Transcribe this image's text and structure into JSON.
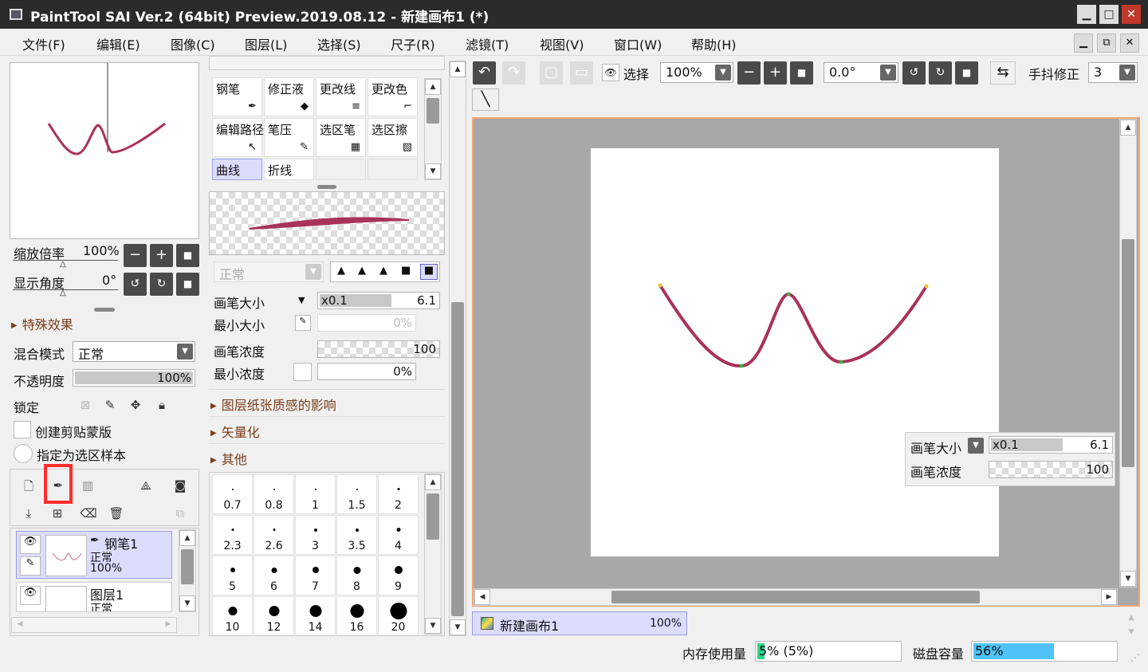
{
  "window": {
    "title": "PaintTool SAI Ver.2 (64bit) Preview.2019.08.12 - 新建画布1 (*)",
    "min": "▁",
    "max": "□",
    "close": "✕"
  },
  "menu": [
    "文件(F)",
    "编辑(E)",
    "图像(C)",
    "图层(L)",
    "选择(S)",
    "尺子(R)",
    "滤镜(T)",
    "视图(V)",
    "窗口(W)",
    "帮助(H)"
  ],
  "mdi": {
    "min": "▁",
    "restore": "⧉",
    "close": "✕"
  },
  "navigator": {
    "zoom_label": "缩放倍率",
    "zoom_value": "100%",
    "angle_label": "显示角度",
    "angle_value": "0°"
  },
  "layer_props": {
    "effects": "特殊效果",
    "blend_label": "混合模式",
    "blend_value": "正常",
    "opacity_label": "不透明度",
    "opacity_value": "100%",
    "lock_label": "锁定",
    "clip_label": "创建剪贴蒙版",
    "sample_label": "指定为选区样本"
  },
  "layers": [
    {
      "name": "钢笔1",
      "mode": "正常",
      "opacity": "100%",
      "selected": true
    },
    {
      "name": "图层1",
      "mode": "正常",
      "opacity": "",
      "selected": false
    }
  ],
  "tools": [
    {
      "name": "钢笔",
      "icon": "✒"
    },
    {
      "name": "修正液",
      "icon": "◆"
    },
    {
      "name": "更改线",
      "icon": "≡"
    },
    {
      "name": "更改色",
      "icon": "⌐"
    },
    {
      "name": "编辑路径",
      "icon": "↖"
    },
    {
      "name": "笔压",
      "icon": "✎"
    },
    {
      "name": "选区笔",
      "icon": "▦"
    },
    {
      "name": "选区擦",
      "icon": "▧"
    },
    {
      "name": "曲线",
      "icon": ""
    },
    {
      "name": "折线",
      "icon": ""
    }
  ],
  "brush": {
    "blend_value": "正常",
    "size_label": "画笔大小",
    "size_mult": "x0.1",
    "size_value": "6.1",
    "min_size_label": "最小大小",
    "min_size_value": "0%",
    "density_label": "画笔浓度",
    "density_value": "100",
    "min_density_label": "最小浓度",
    "min_density_value": "0%",
    "sections": [
      "图层纸张质感的影响",
      "矢量化",
      "其他"
    ],
    "presets": [
      "0.7",
      "0.8",
      "1",
      "1.5",
      "2",
      "2.3",
      "2.6",
      "3",
      "3.5",
      "4",
      "5",
      "6",
      "7",
      "8",
      "9",
      "10",
      "12",
      "14",
      "16",
      "20"
    ]
  },
  "toolbar": {
    "select_label": "选择",
    "zoom_value": "100%",
    "angle_value": "0.0°",
    "stabilizer_label": "手抖修正",
    "stabilizer_value": "3"
  },
  "overlay": {
    "size_label": "画笔大小",
    "size_mult": "x0.1",
    "size_value": "6.1",
    "density_label": "画笔浓度",
    "density_value": "100"
  },
  "canvas_tab": {
    "name": "新建画布1",
    "zoom": "100%"
  },
  "status": {
    "mem_label": "内存使用量",
    "mem_value": "5% (5%)",
    "mem_fraction": 0.05,
    "disk_label": "磁盘容量",
    "disk_value": "56%",
    "disk_fraction": 0.56
  },
  "colors": {
    "stroke": "#a8325a",
    "accent_sel": "#dcdcff",
    "highlight": "#ff2d2d",
    "mem_fill": "#2fd08a",
    "disk_fill": "#4fc3f7"
  }
}
